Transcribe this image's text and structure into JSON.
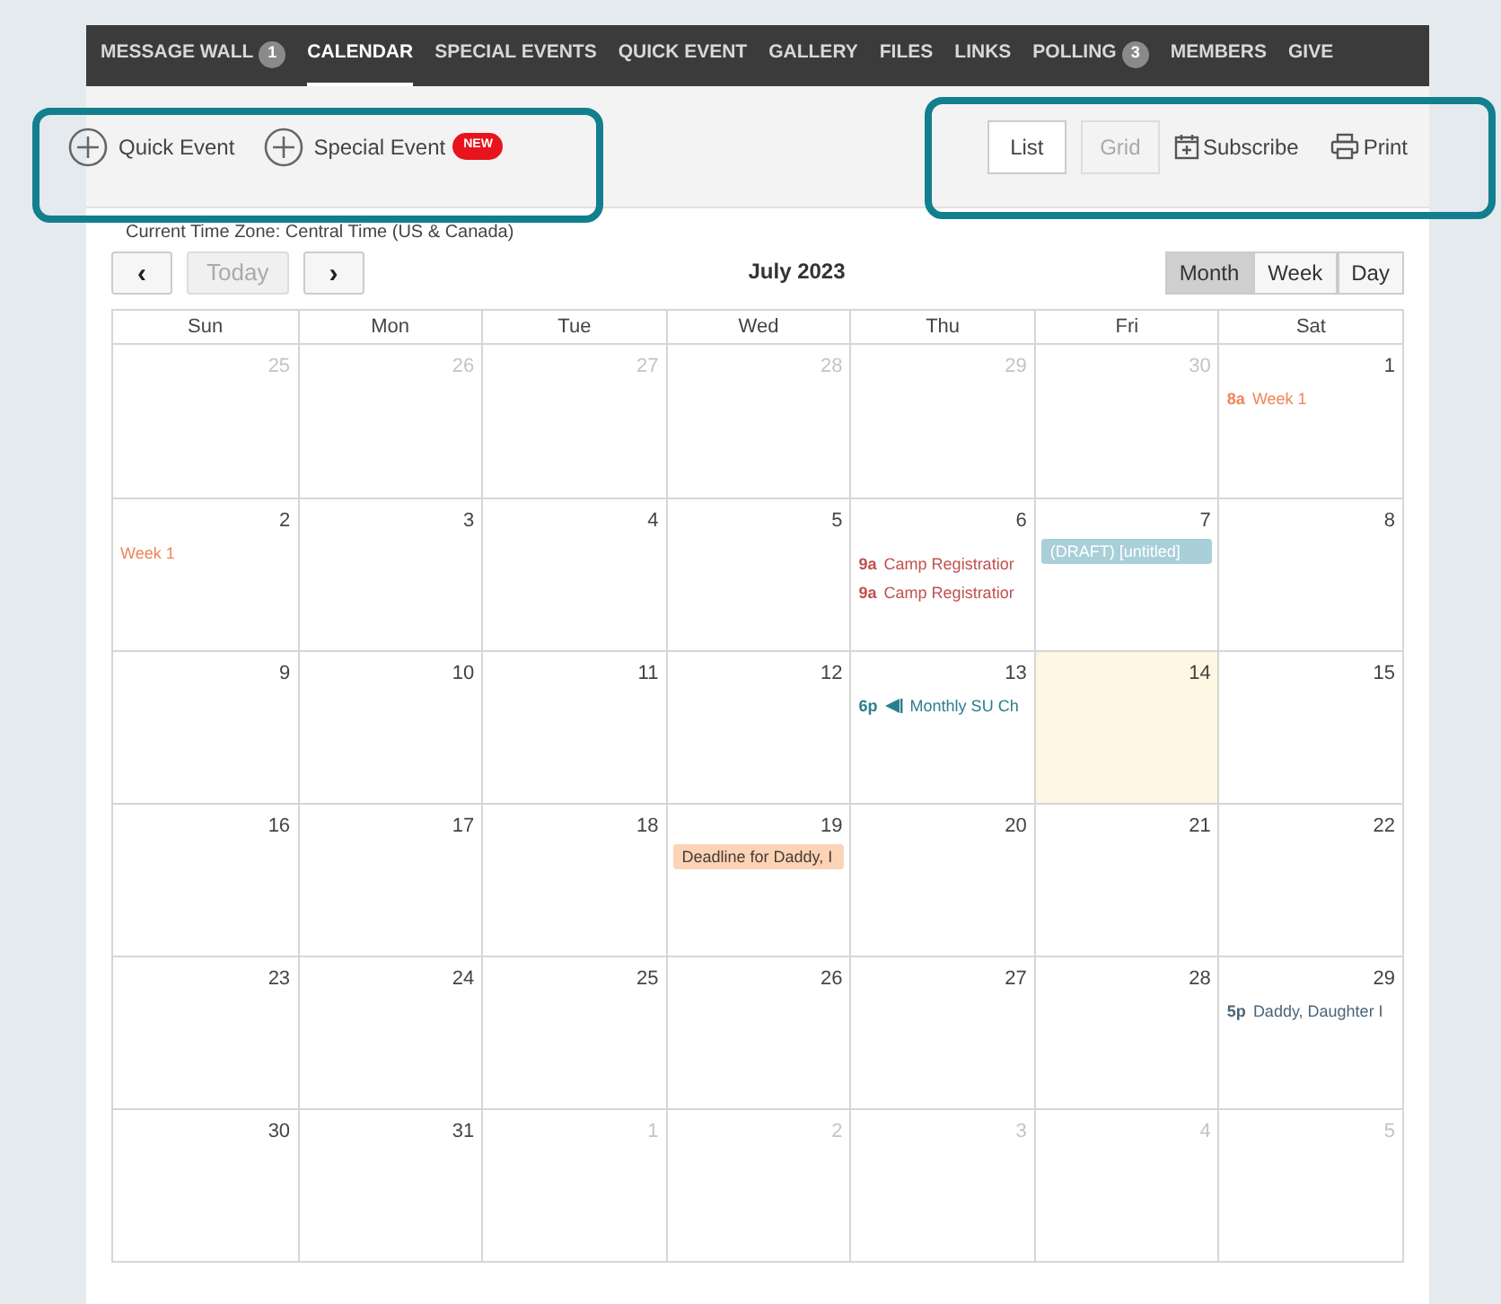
{
  "nav": [
    {
      "label": "MESSAGE WALL",
      "badge": "1",
      "selected": false
    },
    {
      "label": "CALENDAR",
      "selected": true
    },
    {
      "label": "SPECIAL EVENTS",
      "selected": false
    },
    {
      "label": "QUICK EVENT",
      "selected": false
    },
    {
      "label": "GALLERY",
      "selected": false
    },
    {
      "label": "FILES",
      "selected": false
    },
    {
      "label": "LINKS",
      "selected": false
    },
    {
      "label": "POLLING",
      "badge": "3",
      "selected": false
    },
    {
      "label": "MEMBERS",
      "selected": false
    },
    {
      "label": "GIVE",
      "selected": false
    }
  ],
  "actions": [
    {
      "label": "Quick Event"
    },
    {
      "label": "Special Event",
      "badge": "NEW"
    }
  ],
  "layout_toggle": [
    {
      "label": "List",
      "selected": true
    },
    {
      "label": "Grid",
      "selected": false
    }
  ],
  "links": [
    {
      "kind": "subscribe",
      "label": "Subscribe"
    },
    {
      "kind": "print",
      "label": "Print"
    }
  ],
  "timezone": "Current Time Zone: Central Time (US & Canada)",
  "month_title": "July 2023",
  "today_button": {
    "label": "Today",
    "disabled": true
  },
  "prev_button": "‹",
  "next_button": "›",
  "views": [
    {
      "label": "Month",
      "selected": true
    },
    {
      "label": "Week",
      "selected": false
    },
    {
      "label": "Day",
      "selected": false
    }
  ],
  "weekdays": [
    "Sun",
    "Mon",
    "Tue",
    "Wed",
    "Thu",
    "Fri",
    "Sat"
  ],
  "weeks": [
    [
      {
        "day": "25",
        "other_month": true
      },
      {
        "day": "26",
        "other_month": true
      },
      {
        "day": "27",
        "other_month": true
      },
      {
        "day": "28",
        "other_month": true
      },
      {
        "day": "29",
        "other_month": true
      },
      {
        "day": "30",
        "other_month": true
      },
      {
        "day": "1",
        "other_month": false,
        "events": [
          {
            "kind": "timed",
            "time": "8a",
            "title": "Week 1",
            "color": "#f0845a"
          }
        ]
      }
    ],
    [
      {
        "day": "2",
        "other_month": false,
        "events": [
          {
            "kind": "timed",
            "title": "Week 1",
            "color": "#f0845a"
          }
        ]
      },
      {
        "day": "3",
        "other_month": false
      },
      {
        "day": "4",
        "other_month": false
      },
      {
        "day": "5",
        "other_month": false
      },
      {
        "day": "6",
        "other_month": false,
        "events": [
          {
            "kind": "spacer"
          },
          {
            "kind": "timed",
            "time": "9a",
            "title": "Camp Registratior",
            "color": "#c0504d"
          },
          {
            "kind": "timed",
            "time": "9a",
            "title": "Camp Registratior",
            "color": "#c0504d"
          }
        ]
      },
      {
        "day": "7",
        "other_month": false,
        "events": [
          {
            "kind": "bar",
            "title": "(DRAFT) [untitled]",
            "color": "#a9cfd8"
          }
        ]
      },
      {
        "day": "8",
        "other_month": false
      }
    ],
    [
      {
        "day": "9",
        "other_month": false
      },
      {
        "day": "10",
        "other_month": false
      },
      {
        "day": "11",
        "other_month": false
      },
      {
        "day": "12",
        "other_month": false
      },
      {
        "day": "13",
        "other_month": false,
        "events": [
          {
            "kind": "flagged",
            "time": "6p",
            "title": "Monthly SU Ch",
            "color": "#2a7f8c"
          }
        ]
      },
      {
        "day": "14",
        "other_month": false,
        "today": true
      },
      {
        "day": "15",
        "other_month": false
      }
    ],
    [
      {
        "day": "16",
        "other_month": false
      },
      {
        "day": "17",
        "other_month": false
      },
      {
        "day": "18",
        "other_month": false
      },
      {
        "day": "19",
        "other_month": false,
        "events": [
          {
            "kind": "bar",
            "title": "Deadline for Daddy, I",
            "color": "#fbd4b8"
          }
        ]
      },
      {
        "day": "20",
        "other_month": false
      },
      {
        "day": "21",
        "other_month": false
      },
      {
        "day": "22",
        "other_month": false
      }
    ],
    [
      {
        "day": "23",
        "other_month": false
      },
      {
        "day": "24",
        "other_month": false
      },
      {
        "day": "25",
        "other_month": false
      },
      {
        "day": "26",
        "other_month": false
      },
      {
        "day": "27",
        "other_month": false
      },
      {
        "day": "28",
        "other_month": false
      },
      {
        "day": "29",
        "other_month": false,
        "events": [
          {
            "kind": "timed",
            "time": "5p",
            "title": "Daddy, Daughter I",
            "color": "#4a6478"
          }
        ]
      }
    ],
    [
      {
        "day": "30",
        "other_month": false
      },
      {
        "day": "31",
        "other_month": false
      },
      {
        "day": "1",
        "other_month": true
      },
      {
        "day": "2",
        "other_month": true
      },
      {
        "day": "3",
        "other_month": true
      },
      {
        "day": "4",
        "other_month": true
      },
      {
        "day": "5",
        "other_month": true
      }
    ]
  ]
}
